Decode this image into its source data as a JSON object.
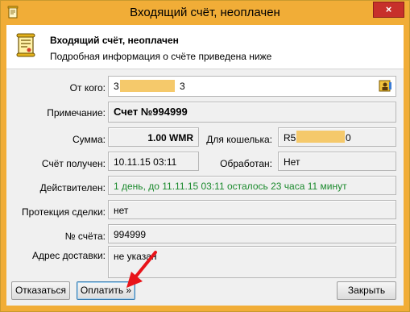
{
  "window": {
    "title": "Входящий счёт, неоплачен",
    "close_symbol": "×"
  },
  "header": {
    "title": "Входящий счёт, неоплачен",
    "subtitle": "Подробная информация о счёте приведена ниже"
  },
  "form": {
    "from_label": "От кого:",
    "from_value_start": "3",
    "from_value_end": "3",
    "note_label": "Примечание:",
    "note_value": "Счет №994999",
    "amount_label": "Сумма:",
    "amount_value": "1.00 WMR",
    "purse_label": "Для кошелька:",
    "purse_value_start": "R5",
    "purse_value_end": "0",
    "received_label": "Счёт получен:",
    "received_value": "10.11.15 03:11",
    "processed_label": "Обработан:",
    "processed_value": "Нет",
    "valid_label": "Действителен:",
    "valid_value": "1 день, до 11.11.15 03:11 осталось 23 часа 11 минут",
    "protection_label": "Протекция сделки:",
    "protection_value": "нет",
    "invoice_no_label": "№ счёта:",
    "invoice_no_value": "994999",
    "address_label": "Адрес доставки:",
    "address_value": "не указан"
  },
  "buttons": {
    "refuse": "Отказаться",
    "pay": "Оплатить »",
    "close": "Закрыть"
  },
  "colors": {
    "frame": "#f1ad37",
    "valid_text": "#1b8a2d",
    "arrow": "#e8141a",
    "redaction": "#f5c96b"
  },
  "icons": {
    "title": "invoice-scroll-icon",
    "header": "invoice-scroll-icon",
    "contact": "address-book-icon",
    "pointer": "red-arrow-icon"
  }
}
